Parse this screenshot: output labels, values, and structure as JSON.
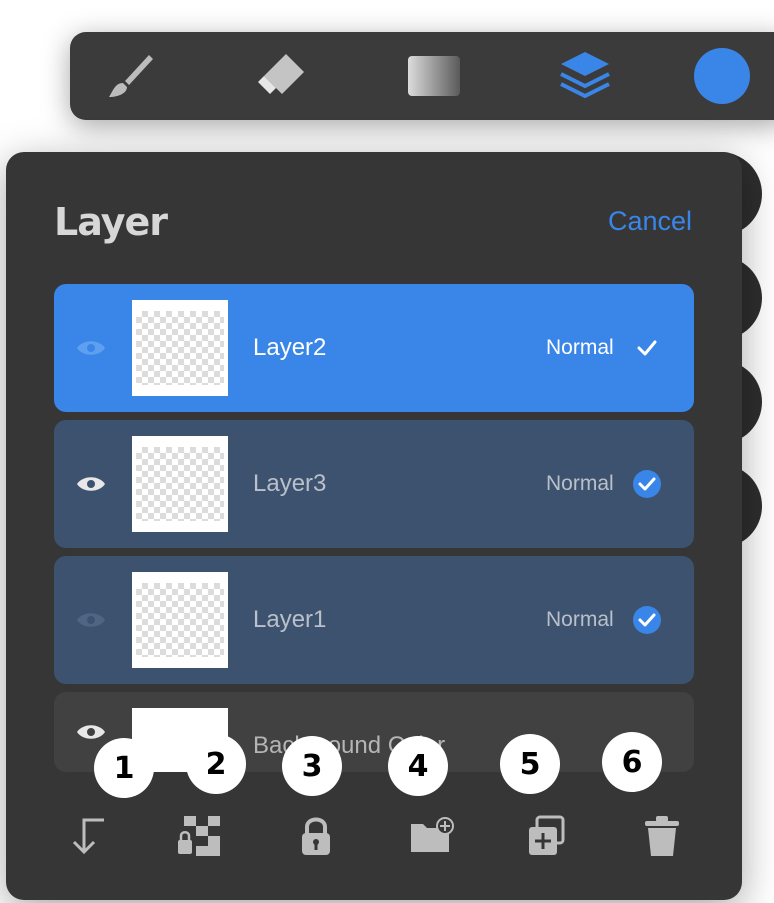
{
  "toolbar": {
    "items": [
      {
        "icon": "brush-icon"
      },
      {
        "icon": "eraser-icon"
      },
      {
        "icon": "gradient-icon"
      },
      {
        "icon": "layers-icon",
        "active": true
      },
      {
        "icon": "color-swatch",
        "color": "#3a86e8"
      }
    ]
  },
  "panel": {
    "title": "Layer",
    "cancel_label": "Cancel"
  },
  "layers": [
    {
      "name": "Layer2",
      "mode": "Normal",
      "state": "active",
      "visible": true
    },
    {
      "name": "Layer3",
      "mode": "Normal",
      "state": "selected",
      "visible": true
    },
    {
      "name": "Layer1",
      "mode": "Normal",
      "state": "selected",
      "visible": false
    },
    {
      "name": "Background Color",
      "mode": "",
      "state": "normal",
      "visible": true
    }
  ],
  "badges": [
    "1",
    "2",
    "3",
    "4",
    "5",
    "6"
  ],
  "actions": [
    {
      "icon": "merge-down-icon"
    },
    {
      "icon": "alpha-lock-icon"
    },
    {
      "icon": "lock-icon"
    },
    {
      "icon": "new-group-icon"
    },
    {
      "icon": "duplicate-icon"
    },
    {
      "icon": "trash-icon"
    }
  ],
  "colors": {
    "accent": "#3a86e8",
    "panel": "#363636",
    "selected_row": "#3d526f"
  }
}
